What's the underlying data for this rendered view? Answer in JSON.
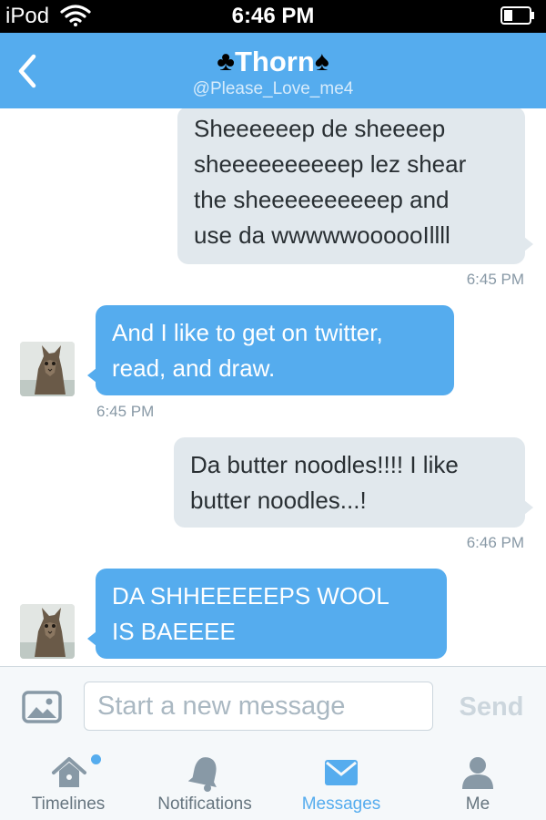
{
  "status_bar": {
    "carrier": "iPod",
    "time": "6:46 PM"
  },
  "header": {
    "title": "Thorn",
    "title_left_icon": "club-suit-icon",
    "title_right_icon": "spade-suit-icon",
    "handle": "@Please_Love_me4"
  },
  "messages": [
    {
      "side": "out",
      "lines": [
        "Sheeeeeep de sheeeep",
        "sheeeeeeeeeep lez shear",
        "the sheeeeeeeeeep and",
        "use da wwwwwoooooIllll"
      ],
      "time": "6:45 PM"
    },
    {
      "side": "in",
      "lines": [
        "And I like to get on twitter,",
        "read, and draw."
      ],
      "time": "6:45 PM"
    },
    {
      "side": "out",
      "lines": [
        "Da butter noodles!!!! I like",
        "butter noodles...!"
      ],
      "time": "6:46 PM"
    },
    {
      "side": "in",
      "lines": [
        "DA SHHEEEEEPS WOOL",
        "IS BAEEEE"
      ]
    }
  ],
  "composer": {
    "placeholder": "Start a new message",
    "send_label": "Send"
  },
  "tabs": [
    {
      "label": "Timelines",
      "icon": "home-icon",
      "has_badge": true
    },
    {
      "label": "Notifications",
      "icon": "bell-icon"
    },
    {
      "label": "Messages",
      "icon": "envelope-icon",
      "active": true
    },
    {
      "label": "Me",
      "icon": "person-icon"
    }
  ],
  "colors": {
    "accent": "#55acee",
    "outgoing_bubble": "#e1e8ed",
    "incoming_bubble": "#55acee",
    "text_dark": "#292f33",
    "muted": "#8899a6"
  }
}
